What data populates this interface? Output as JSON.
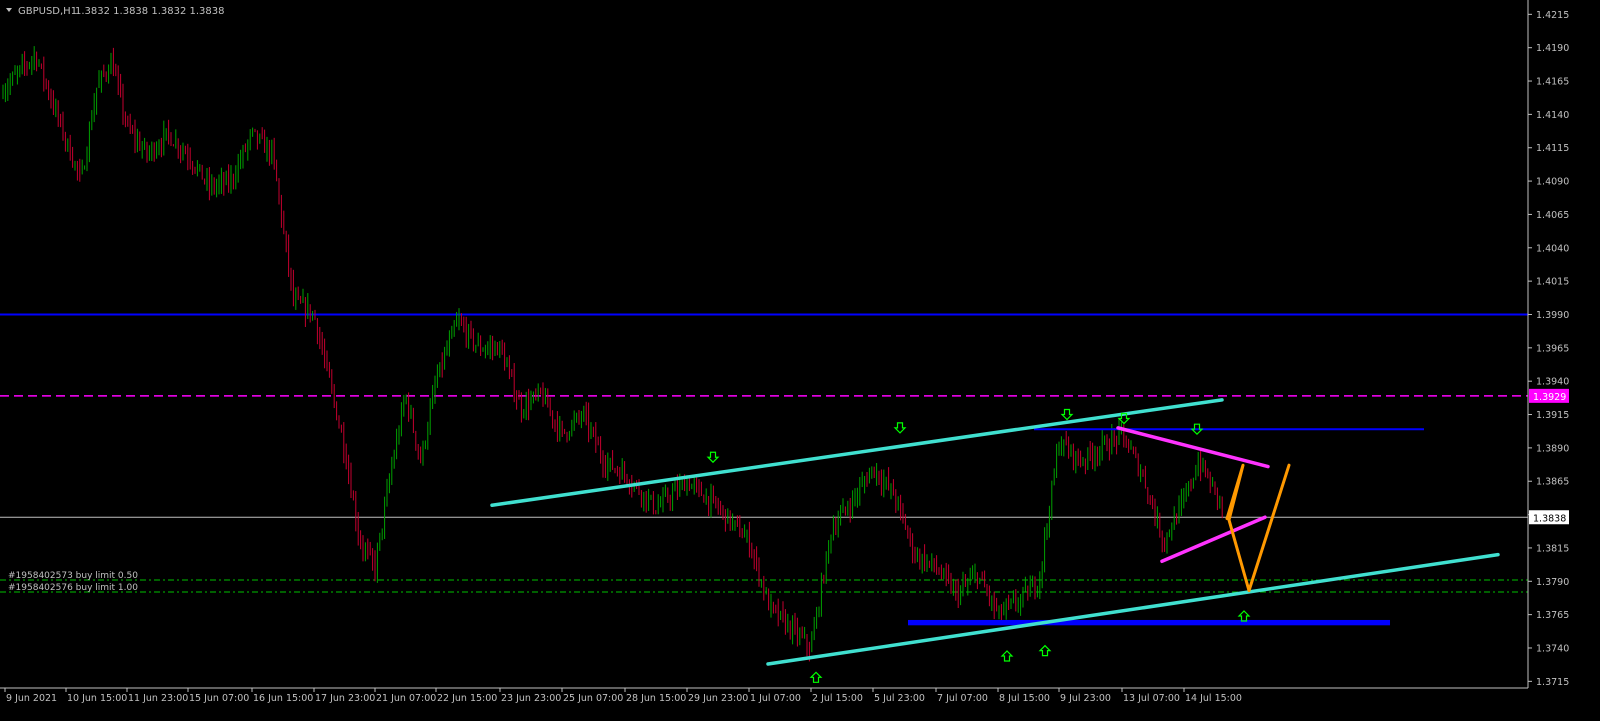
{
  "header": {
    "symbol": "GBPUSD,H1",
    "ohlc": "1.3832 1.3838 1.3832 1.3838"
  },
  "price_axis": {
    "ticks": [
      "1.4215",
      "1.4190",
      "1.4165",
      "1.4140",
      "1.4115",
      "1.4090",
      "1.4065",
      "1.4040",
      "1.4015",
      "1.3990",
      "1.3965",
      "1.3940",
      "1.3915",
      "1.3890",
      "1.3865",
      "1.3840",
      "1.3815",
      "1.3790",
      "1.3765",
      "1.3740",
      "1.3715"
    ],
    "current_price_label": "1.3838",
    "magenta_level_label": "1.3929"
  },
  "time_axis": {
    "labels": [
      "9 Jun 2021",
      "10 Jun 15:00",
      "11 Jun 23:00",
      "15 Jun 07:00",
      "16 Jun 15:00",
      "17 Jun 23:00",
      "21 Jun 07:00",
      "22 Jun 15:00",
      "23 Jun 23:00",
      "25 Jun 07:00",
      "28 Jun 15:00",
      "29 Jun 23:00",
      "1 Jul 07:00",
      "2 Jul 15:00",
      "5 Jul 23:00",
      "7 Jul 07:00",
      "8 Jul 15:00",
      "9 Jul 23:00",
      "13 Jul 07:00",
      "14 Jul 15:00"
    ]
  },
  "orders": [
    {
      "label": "#1958402573 buy limit 0.50",
      "price": 1.3791
    },
    {
      "label": "#1958402576 buy limit 1.00",
      "price": 1.3782
    }
  ],
  "colors": {
    "background": "#000000",
    "bull": "#00a000",
    "bear": "#c4002f",
    "axis": "#c0c0c0",
    "channel": "#40e0d0",
    "wedge": "#ff33ff",
    "projection": "#ff9900",
    "level_blue": "#0000ff",
    "order_line": "#00c000",
    "magenta_dash": "#ff00ff",
    "current_line": "#c0c0c0",
    "arrow": "#00ff00"
  },
  "chart_data": {
    "type": "candlestick",
    "symbol": "GBPUSD",
    "timeframe": "H1",
    "ylim": [
      1.371,
      1.4222
    ],
    "price_path": [
      [
        "9 Jun 2021",
        1.416
      ],
      [
        "9 Jun 2021",
        1.4185
      ],
      [
        "10 Jun 15:00",
        1.412
      ],
      [
        "10 Jun 15:00",
        1.409
      ],
      [
        "10 Jun 15:00",
        1.416
      ],
      [
        "10 Jun 15:00",
        1.418
      ],
      [
        "11 Jun 23:00",
        1.413
      ],
      [
        "11 Jun 23:00",
        1.411
      ],
      [
        "11 Jun 23:00",
        1.4125
      ],
      [
        "15 Jun 07:00",
        1.411
      ],
      [
        "15 Jun 07:00",
        1.4085
      ],
      [
        "15 Jun 07:00",
        1.409
      ],
      [
        "16 Jun 15:00",
        1.4125
      ],
      [
        "16 Jun 15:00",
        1.411
      ],
      [
        "16 Jun 15:00",
        1.4
      ],
      [
        "17 Jun 23:00",
        1.399
      ],
      [
        "17 Jun 23:00",
        1.394
      ],
      [
        "17 Jun 23:00",
        1.389
      ],
      [
        "17 Jun 23:00",
        1.382
      ],
      [
        "21 Jun 07:00",
        1.38
      ],
      [
        "21 Jun 07:00",
        1.387
      ],
      [
        "21 Jun 07:00",
        1.393
      ],
      [
        "21 Jun 07:00",
        1.388
      ],
      [
        "22 Jun 15:00",
        1.394
      ],
      [
        "22 Jun 15:00",
        1.3985
      ],
      [
        "22 Jun 15:00",
        1.3965
      ],
      [
        "23 Jun 23:00",
        1.3965
      ],
      [
        "23 Jun 23:00",
        1.392
      ],
      [
        "23 Jun 23:00",
        1.393
      ],
      [
        "25 Jun 07:00",
        1.39
      ],
      [
        "25 Jun 07:00",
        1.3915
      ],
      [
        "25 Jun 07:00",
        1.388
      ],
      [
        "28 Jun 15:00",
        1.387
      ],
      [
        "28 Jun 15:00",
        1.3845
      ],
      [
        "29 Jun 23:00",
        1.3865
      ],
      [
        "29 Jun 23:00",
        1.3845
      ],
      [
        "1 Jul 07:00",
        1.382
      ],
      [
        "1 Jul 07:00",
        1.377
      ],
      [
        "1 Jul 07:00",
        1.3755
      ],
      [
        "2 Jul 15:00",
        1.374
      ],
      [
        "2 Jul 15:00",
        1.383
      ],
      [
        "2 Jul 15:00",
        1.385
      ],
      [
        "5 Jul 23:00",
        1.3875
      ],
      [
        "5 Jul 23:00",
        1.3855
      ],
      [
        "5 Jul 23:00",
        1.381
      ],
      [
        "7 Jul 07:00",
        1.38
      ],
      [
        "7 Jul 07:00",
        1.378
      ],
      [
        "7 Jul 07:00",
        1.3795
      ],
      [
        "8 Jul 15:00",
        1.3765
      ],
      [
        "8 Jul 15:00",
        1.3775
      ],
      [
        "8 Jul 15:00",
        1.379
      ],
      [
        "9 Jul 23:00",
        1.3895
      ],
      [
        "9 Jul 23:00",
        1.388
      ],
      [
        "9 Jul 23:00",
        1.389
      ],
      [
        "13 Jul 07:00",
        1.39
      ],
      [
        "13 Jul 07:00",
        1.387
      ],
      [
        "13 Jul 07:00",
        1.382
      ],
      [
        "14 Jul 15:00",
        1.385
      ],
      [
        "14 Jul 15:00",
        1.388
      ],
      [
        "14 Jul 15:00",
        1.386
      ],
      [
        "14 Jul 15:00",
        1.3838
      ]
    ],
    "horizontal_levels": [
      {
        "price": 1.399,
        "style": "solid",
        "color": "#0000ff"
      },
      {
        "price": 1.3929,
        "style": "dashed",
        "color": "#ff00ff"
      },
      {
        "price": 1.3838,
        "style": "solid-thin",
        "color": "#c0c0c0"
      }
    ],
    "channel_lines": [
      {
        "from": [
          "28 Jun 15:00",
          1.3847
        ],
        "to": [
          "14 Jul 15:00",
          1.3926
        ]
      },
      {
        "from": [
          "1 Jul 07:00",
          1.3728
        ],
        "to": [
          "14 Jul 15:00",
          1.381
        ]
      }
    ],
    "wedge_lines": [
      {
        "from": [
          "13 Jul 07:00",
          1.3905
        ],
        "to": [
          "14 Jul 15:00",
          1.3876
        ]
      },
      {
        "from": [
          "13 Jul 07:00",
          1.3805
        ],
        "to": [
          "14 Jul 15:00",
          1.3838
        ]
      }
    ],
    "projection_path": [
      [
        "14 Jul 15:00",
        1.3837
      ],
      [
        "14 Jul 15:00",
        1.3877
      ],
      [
        "14 Jul 15:00",
        1.3836
      ],
      [
        "14 Jul 15:00",
        1.3783
      ],
      [
        "14 Jul 15:00",
        1.3877
      ]
    ],
    "support_zone": {
      "from": "7 Jul 07:00",
      "to": "14 Jul 15:00",
      "price_low": 1.3757,
      "price_high": 1.3761
    },
    "resistance_segment": {
      "from": "9 Jul 23:00",
      "to": "14 Jul 15:00",
      "price": 1.3904
    },
    "fractal_arrows": {
      "down": [
        [
          "29 Jun 23:00",
          1.3883
        ],
        [
          "5 Jul 23:00",
          1.3905
        ],
        [
          "9 Jul 23:00",
          1.3915
        ],
        [
          "13 Jul 07:00",
          1.3912
        ],
        [
          "14 Jul 15:00",
          1.3904
        ]
      ],
      "up": [
        [
          "2 Jul 15:00",
          1.3718
        ],
        [
          "8 Jul 15:00",
          1.3734
        ],
        [
          "9 Jul 23:00",
          1.3738
        ],
        [
          "14 Jul 15:00",
          1.3764
        ]
      ]
    }
  }
}
